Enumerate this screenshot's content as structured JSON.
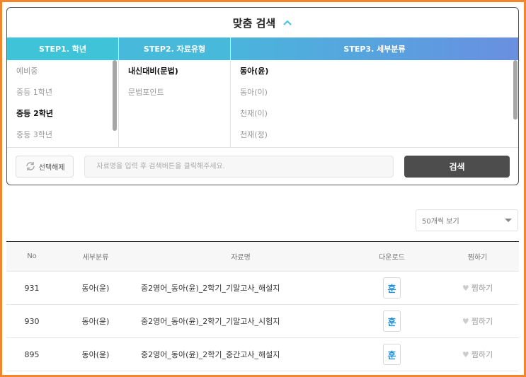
{
  "panel": {
    "title": "맞춤 검색",
    "steps": [
      "STEP1. 학년",
      "STEP2. 자료유형",
      "STEP3. 세부분류"
    ],
    "grades": [
      "예비중",
      "중등 1학년",
      "중등 2학년",
      "중등 3학년"
    ],
    "types": [
      "내신대비(문법)",
      "문법포인트"
    ],
    "subcategories": [
      "동아(윤)",
      "동아(이)",
      "천재(이)",
      "천재(정)"
    ],
    "reset_label": "선택해제",
    "search_placeholder": "자료명을 입력 후 검색버튼을 클릭해주세요.",
    "search_value": "",
    "search_label": "검색"
  },
  "per_page": "50개씩 보기",
  "table": {
    "headers": {
      "no": "No",
      "category": "세부분류",
      "name": "자료명",
      "download": "다운로드",
      "favorite": "찜하기"
    },
    "rows": [
      {
        "no": "931",
        "category": "동아(윤)",
        "name": "중2영어_동아(윤)_2학기_기말고사_해설지",
        "file_icon": "훈",
        "favorite": "찜하기"
      },
      {
        "no": "930",
        "category": "동아(윤)",
        "name": "중2영어_동아(윤)_2학기_기말고사_시험지",
        "file_icon": "훈",
        "favorite": "찜하기"
      },
      {
        "no": "895",
        "category": "동아(윤)",
        "name": "중2영어_동아(윤)_2학기_중간고사_해설지",
        "file_icon": "훈",
        "favorite": "찜하기"
      }
    ]
  },
  "colors": {
    "accent": "#3fc3d8",
    "frame": "#f2862e",
    "dark_button": "#4d4d4d"
  }
}
